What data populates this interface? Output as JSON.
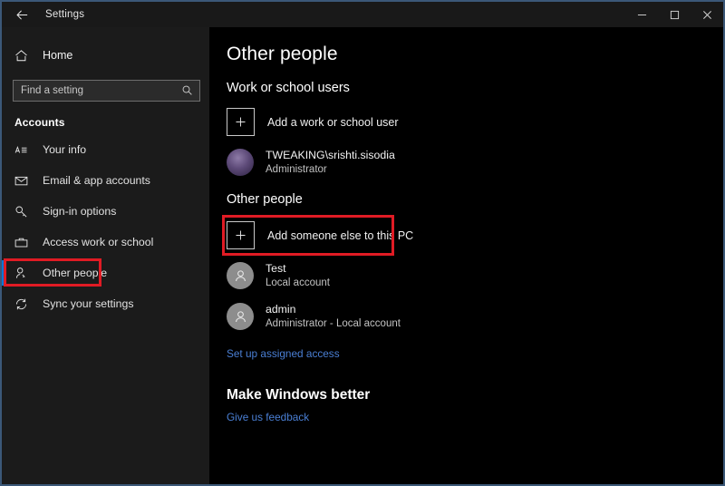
{
  "window": {
    "title": "Settings",
    "back_icon": "back-arrow-icon",
    "controls": {
      "minimize": "minimize-icon",
      "maximize": "maximize-icon",
      "close": "close-icon"
    },
    "border_color": "#3b5878"
  },
  "sidebar": {
    "home": {
      "label": "Home",
      "icon": "home-icon"
    },
    "search": {
      "placeholder": "Find a setting",
      "value": "",
      "icon": "search-icon"
    },
    "group_header": "Accounts",
    "accent_color": "#0078d7",
    "highlight_color": "#e01b24",
    "items": [
      {
        "label": "Your info",
        "icon": "id-card-icon",
        "selected": false
      },
      {
        "label": "Email & app accounts",
        "icon": "envelope-icon",
        "selected": false
      },
      {
        "label": "Sign-in options",
        "icon": "key-icon",
        "selected": false
      },
      {
        "label": "Access work or school",
        "icon": "briefcase-icon",
        "selected": false
      },
      {
        "label": "Other people",
        "icon": "person-icon",
        "selected": true
      },
      {
        "label": "Sync your settings",
        "icon": "sync-icon",
        "selected": false
      }
    ]
  },
  "main": {
    "page_title": "Other people",
    "work_school": {
      "heading": "Work or school users",
      "add_label": "Add a work or school user",
      "add_icon": "plus-icon",
      "user": {
        "name": "TWEAKING\\srishti.sisodia",
        "role": "Administrator",
        "avatar": "user-photo-avatar"
      }
    },
    "other_people": {
      "heading": "Other people",
      "add_label": "Add someone else to this PC",
      "add_icon": "plus-icon",
      "highlighted": true,
      "users": [
        {
          "name": "Test",
          "role": "Local account",
          "avatar": "generic-person-avatar"
        },
        {
          "name": "admin",
          "role": "Administrator - Local account",
          "avatar": "generic-person-avatar"
        }
      ],
      "assigned_access_link": "Set up assigned access"
    },
    "make_windows_better": {
      "heading": "Make Windows better",
      "feedback_link": "Give us feedback"
    }
  }
}
